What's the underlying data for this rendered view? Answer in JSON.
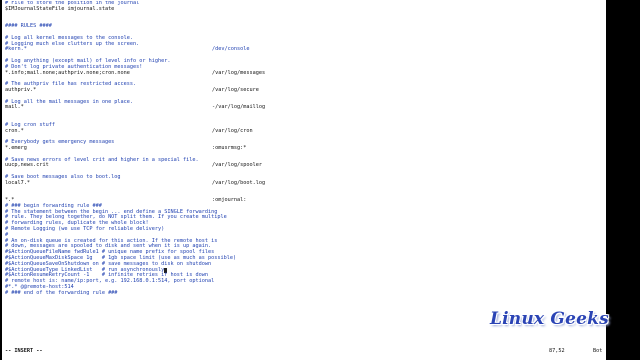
{
  "editor": {
    "lines": [
      {
        "kind": "comment",
        "text": "# File to store the position in the journal"
      },
      {
        "kind": "code",
        "text": "$IMJournalStateFile imjournal.state"
      },
      {
        "kind": "blank",
        "text": ""
      },
      {
        "kind": "blank",
        "text": ""
      },
      {
        "kind": "comment",
        "text": "#### RULES ####"
      },
      {
        "kind": "blank",
        "text": ""
      },
      {
        "kind": "comment",
        "text": "# Log all kernel messages to the console."
      },
      {
        "kind": "comment",
        "text": "# Logging much else clutters up the screen."
      },
      {
        "kind": "comment",
        "selector": "#kern.*",
        "target": "/dev/console"
      },
      {
        "kind": "blank",
        "text": ""
      },
      {
        "kind": "comment",
        "text": "# Log anything (except mail) of level info or higher."
      },
      {
        "kind": "comment",
        "text": "# Don't log private authentication messages!"
      },
      {
        "kind": "code",
        "selector": "*.info;mail.none;authpriv.none;cron.none",
        "target": "/var/log/messages"
      },
      {
        "kind": "blank",
        "text": ""
      },
      {
        "kind": "comment",
        "text": "# The authpriv file has restricted access."
      },
      {
        "kind": "code",
        "selector": "authpriv.*",
        "target": "/var/log/secure"
      },
      {
        "kind": "blank",
        "text": ""
      },
      {
        "kind": "comment",
        "text": "# Log all the mail messages in one place."
      },
      {
        "kind": "code",
        "selector": "mail.*",
        "target": "-/var/log/maillog"
      },
      {
        "kind": "blank",
        "text": ""
      },
      {
        "kind": "blank",
        "text": ""
      },
      {
        "kind": "comment",
        "text": "# Log cron stuff"
      },
      {
        "kind": "code",
        "selector": "cron.*",
        "target": "/var/log/cron"
      },
      {
        "kind": "blank",
        "text": ""
      },
      {
        "kind": "comment",
        "text": "# Everybody gets emergency messages"
      },
      {
        "kind": "code",
        "selector": "*.emerg",
        "target": ":omusrmsg:*"
      },
      {
        "kind": "blank",
        "text": ""
      },
      {
        "kind": "comment",
        "text": "# Save news errors of level crit and higher in a special file."
      },
      {
        "kind": "code",
        "selector": "uucp,news.crit",
        "target": "/var/log/spooler"
      },
      {
        "kind": "blank",
        "text": ""
      },
      {
        "kind": "comment",
        "text": "# Save boot messages also to boot.log"
      },
      {
        "kind": "code",
        "selector": "local7.*",
        "target": "/var/log/boot.log"
      },
      {
        "kind": "blank",
        "text": ""
      },
      {
        "kind": "blank",
        "text": ""
      },
      {
        "kind": "code",
        "selector": "*.*",
        "target": ":omjournal:"
      },
      {
        "kind": "comment",
        "text": "# ### begin forwarding rule ###"
      },
      {
        "kind": "comment",
        "text": "# The statement between the begin ... end define a SINGLE forwarding"
      },
      {
        "kind": "comment",
        "text": "# rule. They belong together, do NOT split them. If you create multiple"
      },
      {
        "kind": "comment",
        "text": "# forwarding rules, duplicate the whole block!"
      },
      {
        "kind": "comment",
        "text": "# Remote Logging (we use TCP for reliable delivery)"
      },
      {
        "kind": "comment",
        "text": "#"
      },
      {
        "kind": "comment",
        "text": "# An on-disk queue is created for this action. If the remote host is"
      },
      {
        "kind": "comment",
        "text": "# down, messages are spooled to disk and sent when it is up again."
      },
      {
        "kind": "comment",
        "text": "#$ActionQueueFileName fwdRule1 # unique name prefix for spool files"
      },
      {
        "kind": "comment",
        "text": "#$ActionQueueMaxDiskSpace 1g   # 1gb space limit (use as much as possible)"
      },
      {
        "kind": "comment",
        "text": "#$ActionQueueSaveOnShutdown on # save messages to disk on shutdown"
      },
      {
        "kind": "comment",
        "text": "#$ActionQueueType LinkedList   # run asynchronously",
        "cursor": true
      },
      {
        "kind": "comment",
        "text": "#$ActionResumeRetryCount -1    # infinite retries if host is down"
      },
      {
        "kind": "comment",
        "text": "# remote host is: name/ip:port, e.g. 192.168.0.1:514, port optional"
      },
      {
        "kind": "comment",
        "text": "#*.* @@remote-host:514"
      },
      {
        "kind": "comment",
        "text": "# ### end of the forwarding rule ###"
      }
    ]
  },
  "status": {
    "mode": "-- INSERT --",
    "position": "87,52",
    "scroll": "Bot"
  },
  "watermark": {
    "text": "Linux Geeks"
  },
  "colors": {
    "comment": "#1e3fb0",
    "code": "#111111",
    "background": "#ffffff",
    "frame": "#000000",
    "watermark": "#2b44b5"
  }
}
